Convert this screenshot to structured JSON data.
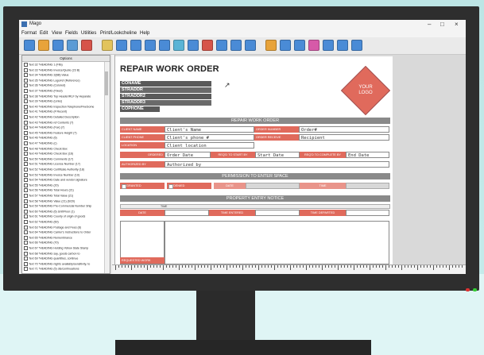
{
  "window": {
    "title": "Mago",
    "controls": {
      "minimize": "–",
      "maximize": "□",
      "close": "×"
    }
  },
  "menu": [
    "Format",
    "Edit",
    "View",
    "Fields",
    "Utilities",
    "Print/Lookcheline",
    "Help"
  ],
  "toolbar": {
    "icons": [
      "new-icon",
      "open-icon",
      "save-icon",
      "print-icon",
      "preview-icon",
      "cut-icon",
      "copy-icon",
      "paste-icon",
      "undo-icon",
      "redo-icon",
      "text-icon",
      "field-icon",
      "line-icon",
      "box-icon",
      "image-icon",
      "table-icon",
      "barcode-icon",
      "align-left-icon",
      "align-right-icon",
      "grid-icon",
      "zoom-in-icon",
      "zoom-out-icon",
      "help-icon"
    ],
    "colors": [
      "#4a8bd6",
      "#e8a33a",
      "#4a8bd6",
      "#5b9bd5",
      "#d6544a",
      "#e2c35c",
      "#4a8bd6",
      "#4a8bd6",
      "#4a8bd6",
      "#4a8bd6",
      "#5ab4d6",
      "#4a8bd6",
      "#d6544a",
      "#4a8bd6",
      "#4a8bd6",
      "#4a8bd6",
      "#e8a33a",
      "#4a8bd6",
      "#4a8bd6",
      "#d65aa8",
      "#4a8bd6",
      "#4a8bd6",
      "#4a8bd6"
    ]
  },
  "sidebar": {
    "header": "Options",
    "fields": [
      "Text 32 *HEADING 1 (Fifa)",
      "Text 33 *HEADING Invoice/Quote (23 B)",
      "Text 34 *HEADING 2(BB) Value",
      "Text 35 *HEADING Logo/ref (Reference)",
      "Text 36 *HEADING (Colored)",
      "Text 37 *HEADING (Fixed)",
      "Text 38 *HEADING Top Header/RLF by Heparate",
      "Text 39 *HEADING (Links)",
      "Text 40 *HEADING Inspection Telephone/FiveSome",
      "Text 41 *HEADING (# Recent)",
      "Text 42 *HEADING Detailed Description",
      "Text 43 *HEADING ref Contents (7)",
      "Text 44 *HEADING (Fax) (7)",
      "Text 45 *HEADING Feature Height (7)",
      "Text 46 *HEADING (6)",
      "Text 47 *HEADING (c)",
      "Text 48 *HEADING Check Box",
      "Text 49 *HEADING Check Box (16)",
      "Text 50 *HEADING Comments (17)",
      "Text 51 *HEADING License Number (17)",
      "Text 52 *HEADING Certificate Authority (18)",
      "Text 53 *HEADING Invoice Number (19)",
      "Text 54 *HEADING Date and vendor signature",
      "Text 55 *HEADING (20)",
      "Text 56 *HEADING Total Hours (21)",
      "Text 57 *HEADING Total Value (21)",
      "Text 58 *HEADING Value (21) (6/20)",
      "Text 59 *HEADING Pre-Commercial Number Ship",
      "Text 60 *HEADING (6) Unit/Floor (1)",
      "Text 61 *HEADING County of origin of goods",
      "Text 62 *HEADING (60)",
      "Text 63 *HEADING Postage and Fees (8)",
      "Text 64 *HEADING Carrier's Instructions to Order",
      "Text 65 *HEADING Remembrance",
      "Text 66 *HEADING (70)",
      "Text 67 *HEADING Holding Yellow Slate Stamp",
      "Text 68 *HEADING say, goods carbon to",
      "Text 69 *HEADING quantities, continue",
      "Text 70 *HEADING nights availably/sensitivity, to",
      "Text 71 *HEADING (5) dis/continuations"
    ]
  },
  "form": {
    "title": "REPAIR WORK ORDER",
    "company_lines": [
      "CONAME",
      "STRADDR",
      "STRADDR2",
      "STRADDR3",
      "COPHONE"
    ],
    "logo": "YOUR LOGO",
    "section1": "REPAIR WORK ORDER",
    "labels": {
      "client_name": "CLIENT NAME",
      "client_phone": "CLIENT PHONE",
      "location": "LOCATION",
      "order_number": "ORDER NUMBER",
      "order_receive": "ORDER RECEIVE",
      "ordered": "ORDERED",
      "req_start": "REQ'D TO START BY",
      "req_complete": "REQ'D TO COMPLETE BY",
      "authorized_by": "AUTHORIZED BY"
    },
    "values": {
      "client_name": "Client's Name",
      "client_phone": "Client's phone #",
      "location": "Client location",
      "order_number": "Order#",
      "order_receive": "Recipient",
      "ordered": "Order Date",
      "req_start": "Start Date",
      "req_complete": "End Date",
      "authorized_by": "Authorized by"
    },
    "section2": "PERMISSION TO ENTER SPACE",
    "permission": {
      "granted": "GRANTED",
      "denied": "DENIED",
      "date": "DATE",
      "time": "TIME"
    },
    "section3": "PROPERTY ENTRY NOTICE",
    "entry_notice": {
      "small_label": "TIME",
      "date": "DATE",
      "time_entered": "TIME ENTERED",
      "time_departed": "TIME DEPARTED"
    },
    "requested_work": "REQUESTED WORK"
  },
  "colors": {
    "accent": "#e06a5c",
    "section_bar": "#8a8a8a",
    "company_bar": "#5a5a5a"
  }
}
